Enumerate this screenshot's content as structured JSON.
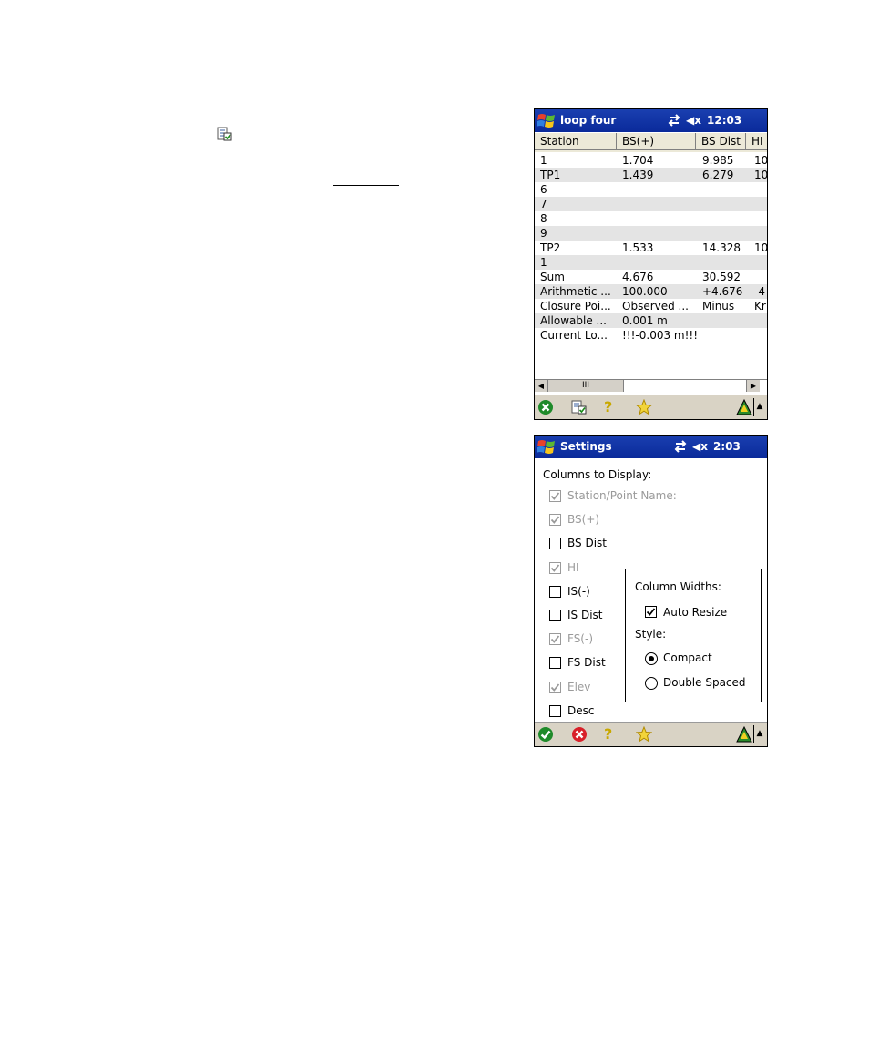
{
  "screen1": {
    "title": "loop four",
    "clock": "12:03",
    "columns": [
      "Station",
      "BS(+)",
      "BS Dist",
      "HI"
    ],
    "rows": [
      [
        "1",
        "1.704",
        "9.985",
        "10"
      ],
      [
        "TP1",
        "1.439",
        "6.279",
        "10"
      ],
      [
        "6",
        "",
        "",
        ""
      ],
      [
        "7",
        "",
        "",
        ""
      ],
      [
        "8",
        "",
        "",
        ""
      ],
      [
        "9",
        "",
        "",
        ""
      ],
      [
        "TP2",
        "1.533",
        "14.328",
        "10"
      ],
      [
        "1",
        "",
        "",
        ""
      ],
      [
        "Sum",
        "4.676",
        "30.592",
        ""
      ],
      [
        "Arithmetic ...",
        "100.000",
        "+4.676",
        "-4"
      ],
      [
        "Closure Poi...",
        "Observed ...",
        "Minus",
        "Kr"
      ],
      [
        "Allowable ...",
        "0.001 m",
        "",
        ""
      ],
      [
        "Current Lo...",
        "!!!-0.003 m!!!",
        "",
        ""
      ]
    ],
    "scroll_thumb": "III"
  },
  "screen2": {
    "title": "Settings",
    "clock": "2:03",
    "columns_label": "Columns to Display:",
    "checkboxes": [
      {
        "label": "Station/Point Name:",
        "checked": true,
        "disabled": true
      },
      {
        "label": "BS(+)",
        "checked": true,
        "disabled": true
      },
      {
        "label": "BS Dist",
        "checked": false,
        "disabled": false
      },
      {
        "label": "HI",
        "checked": true,
        "disabled": true
      },
      {
        "label": "IS(-)",
        "checked": false,
        "disabled": false
      },
      {
        "label": "IS Dist",
        "checked": false,
        "disabled": false
      },
      {
        "label": "FS(-)",
        "checked": true,
        "disabled": true
      },
      {
        "label": "FS Dist",
        "checked": false,
        "disabled": false
      },
      {
        "label": "Elev",
        "checked": true,
        "disabled": true
      },
      {
        "label": "Desc",
        "checked": false,
        "disabled": false
      }
    ],
    "column_widths_label": "Column Widths:",
    "auto_resize_label": "Auto Resize",
    "style_label": "Style:",
    "compact_label": "Compact",
    "double_spaced_label": "Double Spaced"
  },
  "colors": {
    "titlebar": "#0a2a9a",
    "cmdbar": "#d9d3c5",
    "alt_row": "#e4e4e4",
    "disabled_text": "#9a9a9a"
  }
}
